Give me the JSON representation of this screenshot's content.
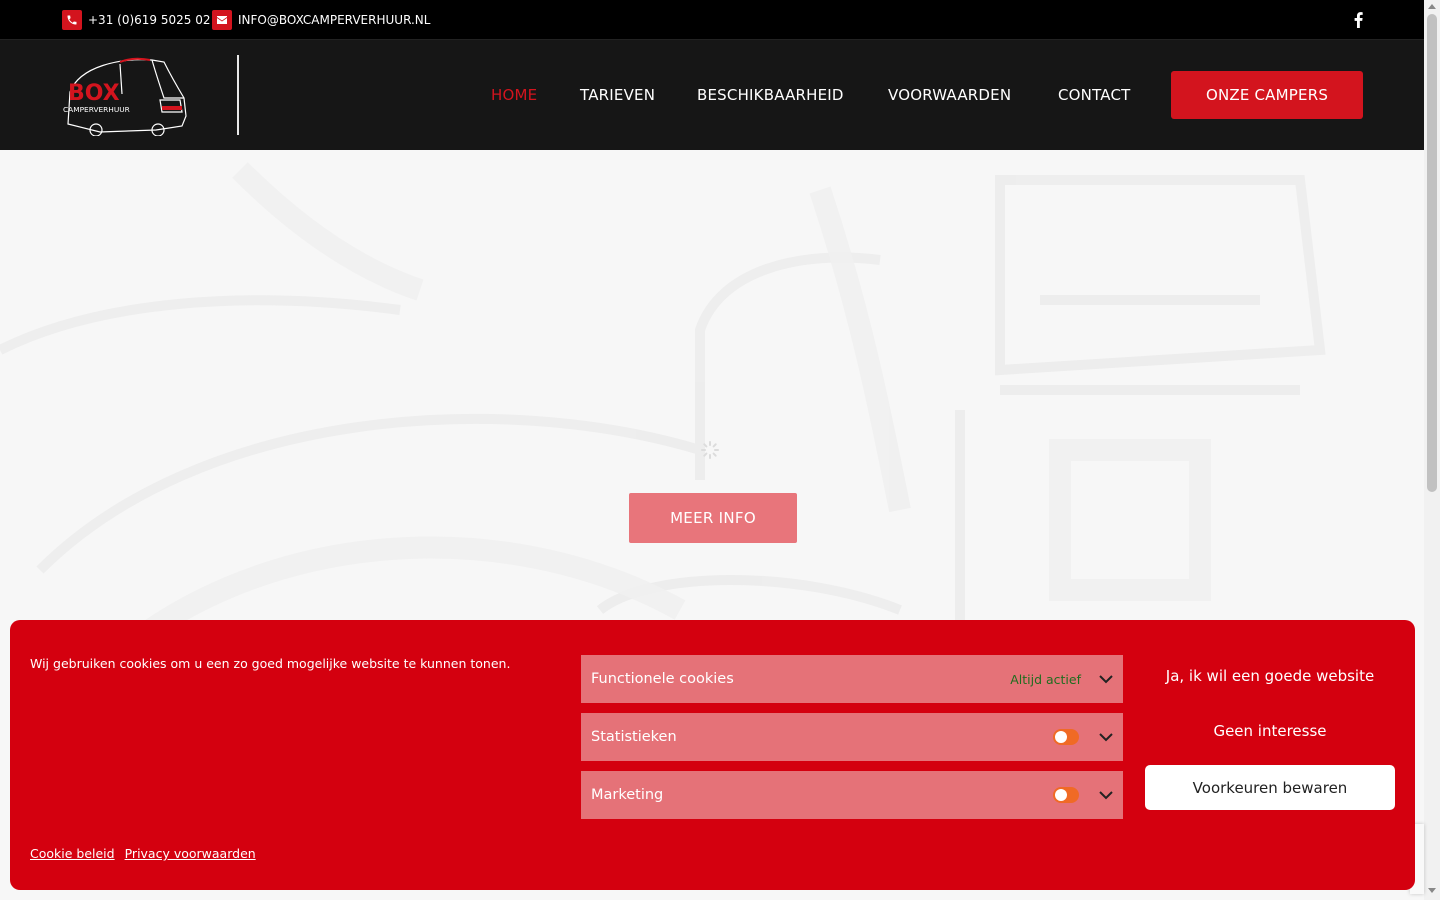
{
  "topbar": {
    "phone": "+31 (0)619 5025 02",
    "email": "INFO@BOXCAMPERVERHUUR.NL"
  },
  "header": {
    "logo_text": "BOX",
    "logo_subtext": "CAMPERVERHUUR",
    "nav": [
      {
        "label": "HOME",
        "active": true
      },
      {
        "label": "TARIEVEN"
      },
      {
        "label": "BESCHIKBAARHEID"
      },
      {
        "label": "VOORWAARDEN"
      },
      {
        "label": "CONTACT"
      }
    ],
    "cta_label": "ONZE CAMPERS"
  },
  "hero": {
    "button_label": "MEER INFO"
  },
  "cookie": {
    "message": "Wij gebruiken cookies om u een zo goed mogelijke website te kunnen tonen.",
    "categories": [
      {
        "label": "Functionele cookies",
        "status": "Altijd actief"
      },
      {
        "label": "Statistieken"
      },
      {
        "label": "Marketing"
      }
    ],
    "accept_label": "Ja, ik wil een goede website",
    "deny_label": "Geen interesse",
    "save_label": "Voorkeuren bewaren",
    "links": [
      "Cookie beleid",
      "Privacy voorwaarden"
    ]
  },
  "colors": {
    "brand_red": "#d3141e",
    "banner_red": "#d4000f",
    "toggle_orange": "#f06a25"
  }
}
